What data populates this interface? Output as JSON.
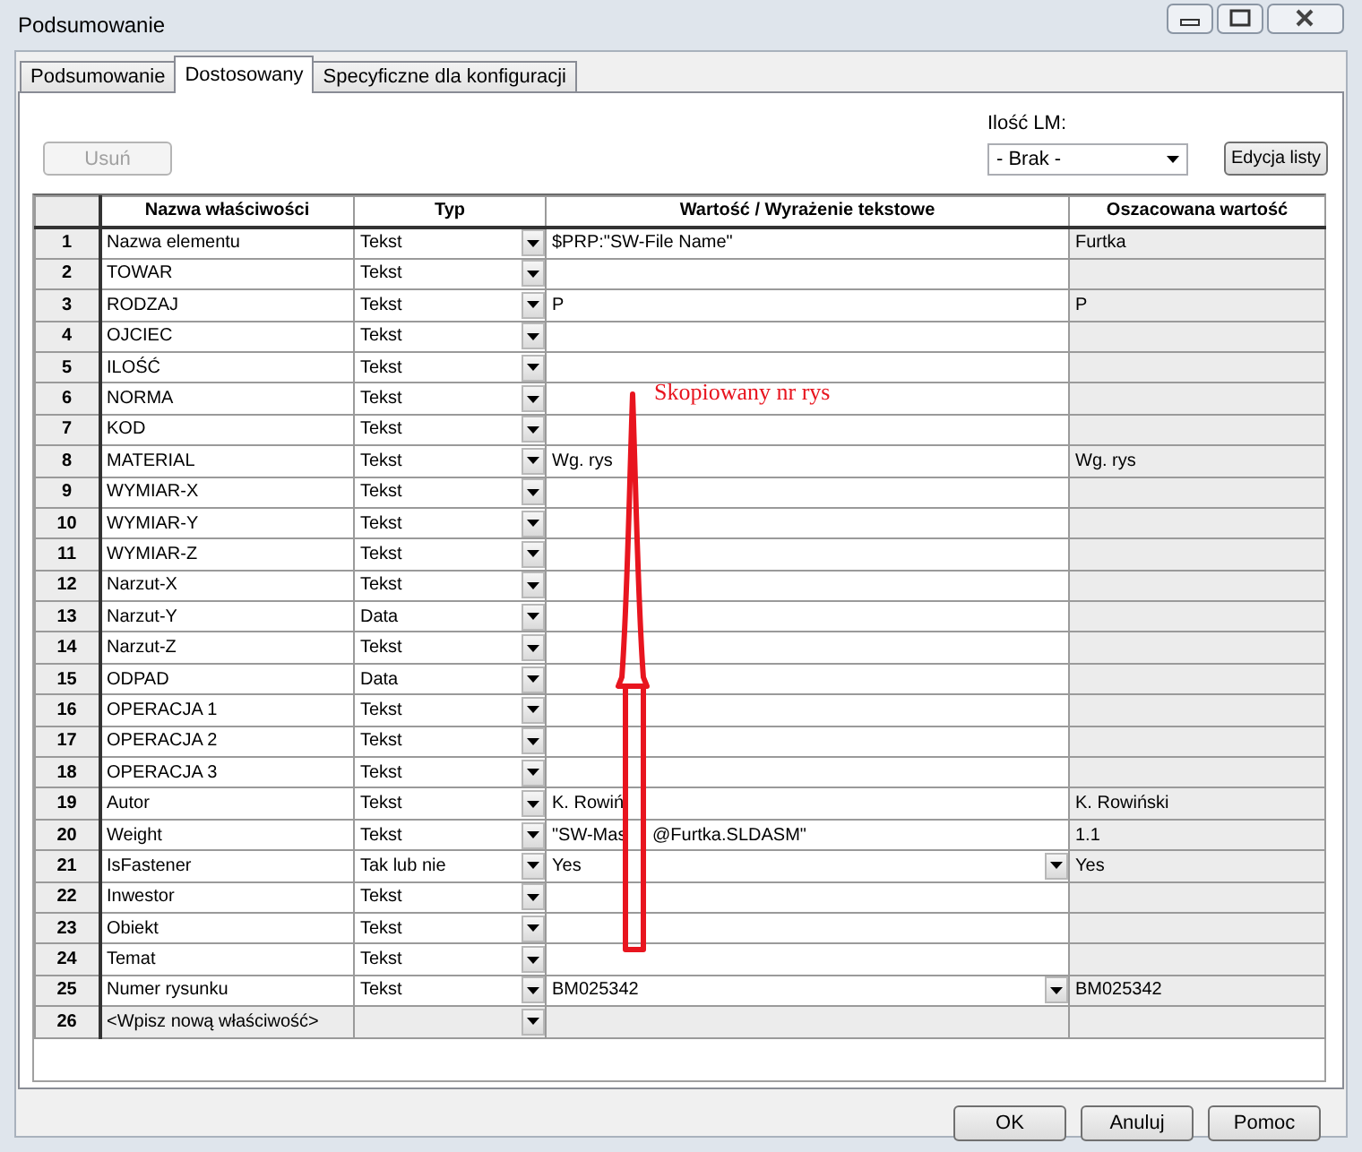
{
  "window": {
    "title": "Podsumowanie"
  },
  "tabs": [
    {
      "label": "Podsumowanie",
      "selected": false
    },
    {
      "label": "Dostosowany",
      "selected": true
    },
    {
      "label": "Specyficzne dla konfiguracji",
      "selected": false
    }
  ],
  "remove_button": {
    "label": "Usuń",
    "disabled": true
  },
  "lm_config": {
    "label": "Ilość LM:",
    "value": "- Brak -"
  },
  "edit_list_button": {
    "label": "Edycja listy"
  },
  "table": {
    "columns": [
      "Nazwa właściwości",
      "Typ",
      "Wartość / Wyrażenie tekstowe",
      "Oszacowana wartość"
    ],
    "rows": [
      {
        "number": "1",
        "name": "Nazwa elementu",
        "type": "Tekst",
        "value": "$PRP:\"SW-File Name\"",
        "estimated": "Furtka"
      },
      {
        "number": "2",
        "name": "TOWAR",
        "type": "Tekst"
      },
      {
        "number": "3",
        "name": "RODZAJ",
        "type": "Tekst",
        "value": "P",
        "estimated": "P"
      },
      {
        "number": "4",
        "name": "OJCIEC",
        "type": "Tekst"
      },
      {
        "number": "5",
        "name": "ILOŚĆ",
        "type": "Tekst"
      },
      {
        "number": "6",
        "name": "NORMA",
        "type": "Tekst"
      },
      {
        "number": "7",
        "name": "KOD",
        "type": "Tekst"
      },
      {
        "number": "8",
        "name": "MATERIAL",
        "type": "Tekst",
        "value": "Wg. rys",
        "estimated": "Wg. rys"
      },
      {
        "number": "9",
        "name": "WYMIAR-X",
        "type": "Tekst"
      },
      {
        "number": "10",
        "name": "WYMIAR-Y",
        "type": "Tekst"
      },
      {
        "number": "11",
        "name": "WYMIAR-Z",
        "type": "Tekst"
      },
      {
        "number": "12",
        "name": "Narzut-X",
        "type": "Tekst"
      },
      {
        "number": "13",
        "name": "Narzut-Y",
        "type": "Data"
      },
      {
        "number": "14",
        "name": "Narzut-Z",
        "type": "Tekst"
      },
      {
        "number": "15",
        "name": "ODPAD",
        "type": "Data"
      },
      {
        "number": "16",
        "name": "OPERACJA 1",
        "type": "Tekst"
      },
      {
        "number": "17",
        "name": "OPERACJA 2",
        "type": "Tekst"
      },
      {
        "number": "18",
        "name": "OPERACJA 3",
        "type": "Tekst"
      },
      {
        "number": "19",
        "name": "Autor",
        "type": "Tekst",
        "value": "K. Rowiń",
        "estimated": "K. Rowiński"
      },
      {
        "number": "20",
        "name": "Weight",
        "type": "Tekst",
        "value": "\"SW-Mas",
        "value_after": "@Furtka.SLDASM\"",
        "estimated": "1.1"
      },
      {
        "number": "21",
        "name": "IsFastener",
        "type": "Tak lub nie",
        "value": "Yes",
        "value_dropdown": true,
        "estimated": "Yes"
      },
      {
        "number": "22",
        "name": "Inwestor",
        "type": "Tekst"
      },
      {
        "number": "23",
        "name": "Obiekt",
        "type": "Tekst"
      },
      {
        "number": "24",
        "name": "Temat",
        "type": "Tekst"
      },
      {
        "number": "25",
        "name": "Numer rysunku",
        "type": "Tekst",
        "value": "BM025342",
        "value_dropdown": true,
        "estimated": "BM025342"
      },
      {
        "number": "26",
        "name": "<Wpisz nową właściwość>",
        "kind": "new"
      }
    ]
  },
  "annotation": {
    "text": "Skopiowany nr rys"
  },
  "buttons": [
    "OK",
    "Anuluj",
    "Pomoc"
  ]
}
